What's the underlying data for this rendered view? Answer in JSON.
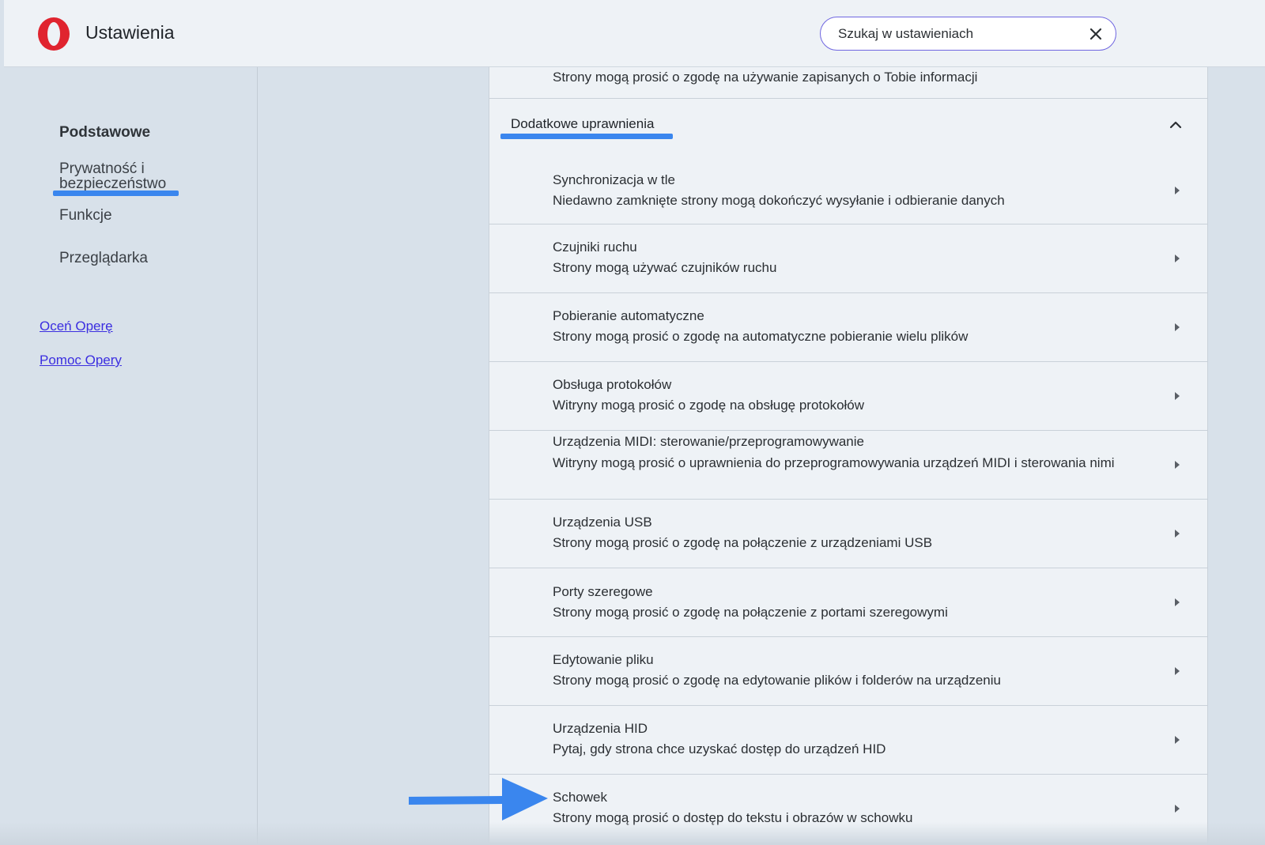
{
  "header": {
    "title": "Ustawienia",
    "search_placeholder": "Szukaj w ustawieniach",
    "logo_color": "#e0242f"
  },
  "sidebar": {
    "items": [
      {
        "label": "Podstawowe",
        "bold": true
      },
      {
        "label": "Prywatność i bezpieczeństwo",
        "active": true
      },
      {
        "label": "Funkcje"
      },
      {
        "label": "Przeglądarka"
      }
    ],
    "links": [
      {
        "label": "Oceń Operę"
      },
      {
        "label": "Pomoc Opery"
      }
    ]
  },
  "main": {
    "top_row_desc": "Strony mogą prosić o zgodę na używanie zapisanych o Tobie informacji",
    "section_title": "Dodatkowe uprawnienia",
    "rows": [
      {
        "title": "Synchronizacja w tle",
        "desc": "Niedawno zamknięte strony mogą dokończyć wysyłanie i odbieranie danych"
      },
      {
        "title": "Czujniki ruchu",
        "desc": "Strony mogą używać czujników ruchu"
      },
      {
        "title": "Pobieranie automatyczne",
        "desc": "Strony mogą prosić o zgodę na automatyczne pobieranie wielu plików"
      },
      {
        "title": "Obsługa protokołów",
        "desc": "Witryny mogą prosić o zgodę na obsługę protokołów"
      },
      {
        "title": "Urządzenia MIDI: sterowanie/przeprogramowywanie",
        "desc": "Witryny mogą prosić o uprawnienia do przeprogramowywania urządzeń MIDI i sterowania nimi"
      },
      {
        "title": "Urządzenia USB",
        "desc": "Strony mogą prosić o zgodę na połączenie z urządzeniami USB"
      },
      {
        "title": "Porty szeregowe",
        "desc": "Strony mogą prosić o zgodę na połączenie z portami szeregowymi"
      },
      {
        "title": "Edytowanie pliku",
        "desc": "Strony mogą prosić o zgodę na edytowanie plików i folderów na urządzeniu"
      },
      {
        "title": "Urządzenia HID",
        "desc": "Pytaj, gdy strona chce uzyskać dostęp do urządzeń HID"
      },
      {
        "title": "Schowek",
        "desc": "Strony mogą prosić o dostęp do tekstu i obrazów w schowku"
      }
    ]
  },
  "annotation_color": "#3a86ee"
}
